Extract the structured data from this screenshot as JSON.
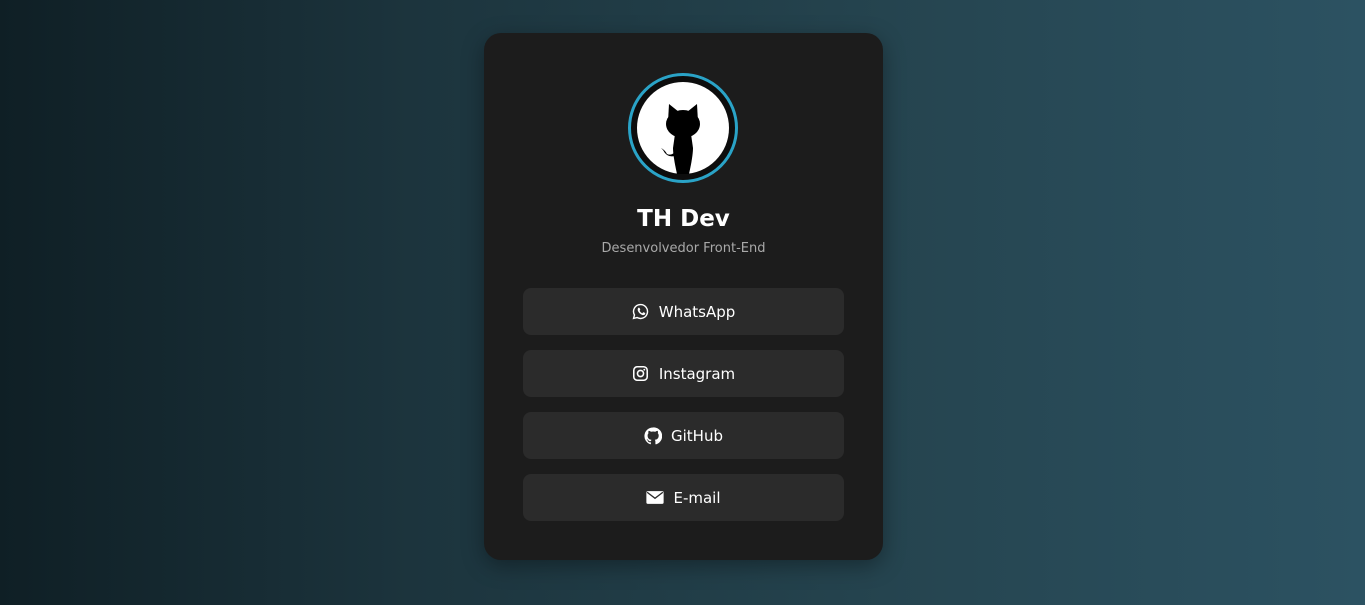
{
  "profile": {
    "avatar_icon": "github-octocat-icon",
    "name": "TH Dev",
    "subtitle": "Desenvolvedor Front-End"
  },
  "links": [
    {
      "label": "WhatsApp",
      "icon": "whatsapp-icon"
    },
    {
      "label": "Instagram",
      "icon": "instagram-icon"
    },
    {
      "label": "GitHub",
      "icon": "github-icon"
    },
    {
      "label": "E-mail",
      "icon": "email-icon"
    }
  ],
  "colors": {
    "card": "#1c1c1c",
    "button": "#2b2b2b",
    "avatar_ring": "#2aa3c7",
    "text": "#ffffff",
    "subtitle": "#a9a9a9"
  }
}
